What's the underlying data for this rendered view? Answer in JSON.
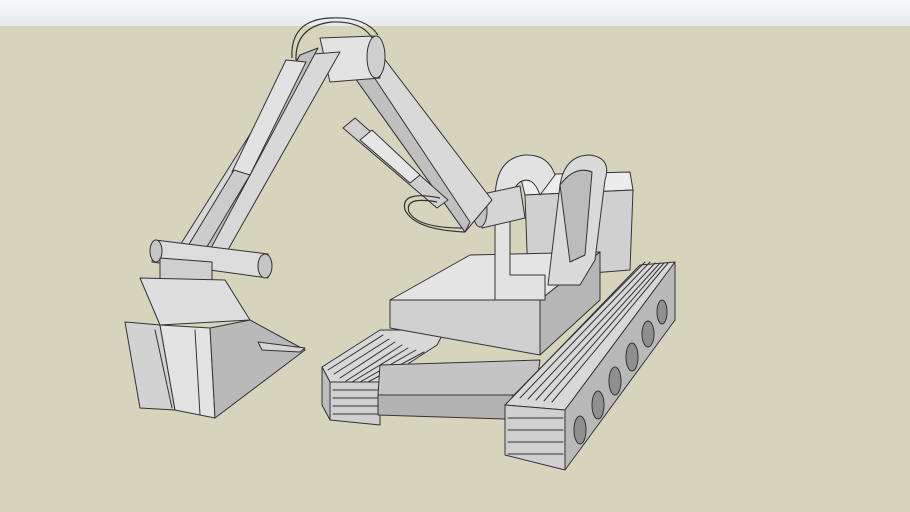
{
  "scene": {
    "subject": "",
    "colors": {
      "sky_top": "#f7f9fa",
      "sky_bottom": "#e6eaec",
      "ground": "#d6d4bc",
      "face_light": "#e6e6e6",
      "face_mid": "#c9c9c9",
      "face_dark": "#a9a9a9",
      "edge": "#333333"
    }
  }
}
